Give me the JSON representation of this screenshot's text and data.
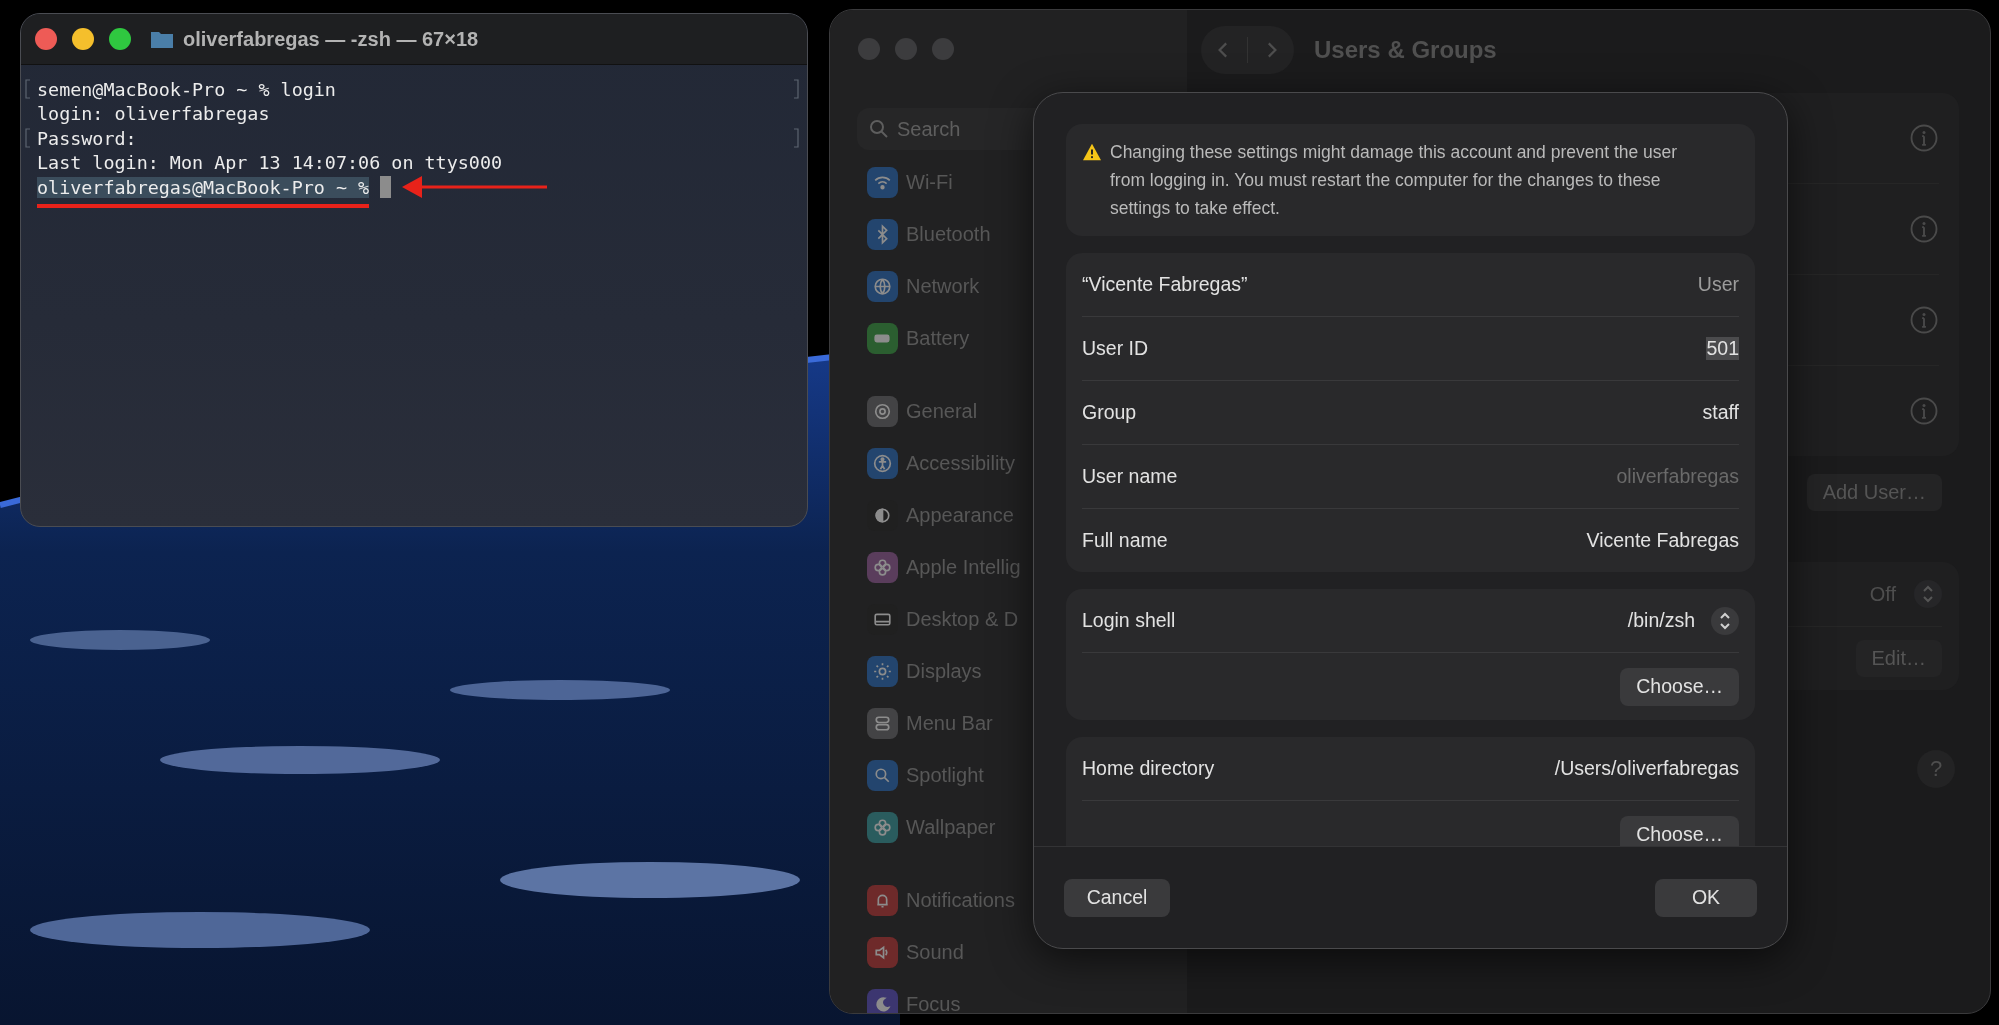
{
  "terminal": {
    "title": "oliverfabregas — -zsh — 67×18",
    "lines": [
      {
        "text": "semen@MacBook-Pro ~ % login",
        "marked": true,
        "selected": false,
        "cursor": false
      },
      {
        "text": "login: oliverfabregas",
        "marked": false,
        "selected": false,
        "cursor": false
      },
      {
        "text": "Password:",
        "marked": true,
        "selected": false,
        "cursor": false
      },
      {
        "text": "Last login: Mon Apr 13 14:07:06 on ttys000",
        "marked": false,
        "selected": false,
        "cursor": false
      },
      {
        "text": "oliverfabregas@MacBook-Pro ~ %",
        "marked": false,
        "selected": true,
        "cursor": true
      }
    ]
  },
  "settings": {
    "search": {
      "placeholder": "Search"
    },
    "sidebar": {
      "groups": [
        {
          "items": [
            {
              "label": "Wi-Fi",
              "color": "#23456e"
            },
            {
              "label": "Bluetooth",
              "color": "#23456e"
            },
            {
              "label": "Network",
              "color": "#23456e"
            },
            {
              "label": "Battery",
              "color": "#2b5e30"
            }
          ]
        },
        {
          "items": [
            {
              "label": "General",
              "color": "#434345"
            },
            {
              "label": "Accessibility",
              "color": "#23456e"
            },
            {
              "label": "Appearance",
              "color": "#202020"
            },
            {
              "label": "Apple Intellig",
              "color": "#5a3d5c"
            },
            {
              "label": "Desktop & D",
              "color": "#202020"
            },
            {
              "label": "Displays",
              "color": "#23456e"
            },
            {
              "label": "Menu Bar",
              "color": "#434345"
            },
            {
              "label": "Spotlight",
              "color": "#23456e"
            },
            {
              "label": "Wallpaper",
              "color": "#2a5c5e"
            }
          ]
        },
        {
          "items": [
            {
              "label": "Notifications",
              "color": "#6e2a2a"
            },
            {
              "label": "Sound",
              "color": "#6e2a2a"
            },
            {
              "label": "Focus",
              "color": "#3c3670"
            }
          ]
        }
      ]
    },
    "title": "Users & Groups",
    "add_user_button": "Add User…",
    "auto_login": {
      "value": "Off"
    },
    "edit_button": "Edit…",
    "help_button": "?"
  },
  "dialog": {
    "warning": "Changing these settings might damage this account and prevent the user from logging in. You must restart the computer for the changes to these settings to take effect.",
    "identity": [
      {
        "label": "“Vicente Fabregas”",
        "value": "User",
        "kind": "type",
        "selected": false,
        "disabled": false
      },
      {
        "label": "User ID",
        "value": "501",
        "kind": "field",
        "selected": true,
        "disabled": false
      },
      {
        "label": "Group",
        "value": "staff",
        "kind": "field",
        "selected": false,
        "disabled": false
      },
      {
        "label": "User name",
        "value": "oliverfabregas",
        "kind": "field",
        "selected": false,
        "disabled": true
      },
      {
        "label": "Full name",
        "value": "Vicente Fabregas",
        "kind": "field",
        "selected": false,
        "disabled": false
      }
    ],
    "paths": [
      {
        "label": "Login shell",
        "value": "/bin/zsh",
        "kind": "popup",
        "button": "Choose…"
      },
      {
        "label": "Home directory",
        "value": "/Users/oliverfabregas",
        "kind": "text",
        "button": "Choose…"
      }
    ],
    "cancel_button": "Cancel",
    "ok_button": "OK"
  }
}
